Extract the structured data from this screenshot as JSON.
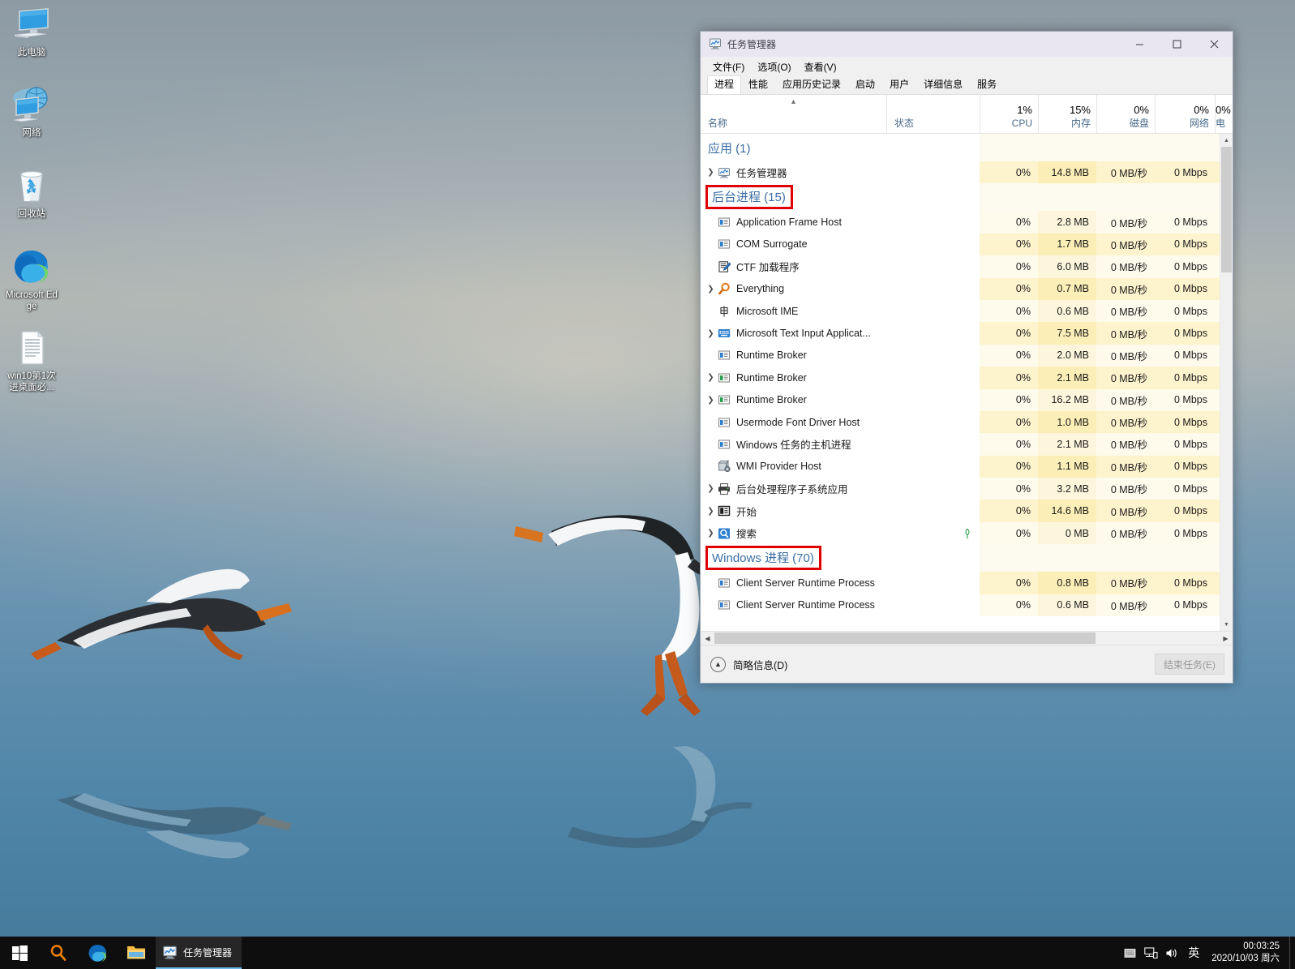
{
  "desktop": {
    "icons": [
      {
        "name": "this-pc",
        "label": "此电脑",
        "icon": "monitor-icon"
      },
      {
        "name": "network",
        "label": "网络",
        "icon": "network-globe-icon"
      },
      {
        "name": "recycle-bin",
        "label": "回收站",
        "icon": "recycle-bin-icon"
      },
      {
        "name": "microsoft-edge",
        "label": "Microsoft Edge",
        "icon": "edge-icon"
      },
      {
        "name": "text-file",
        "label": "win10第1次进桌面必...",
        "icon": "text-document-icon"
      }
    ]
  },
  "taskmanager": {
    "title": "任务管理器",
    "titlebar_icon": "task-manager-icon",
    "window_buttons": {
      "minimize": "─",
      "maximize": "☐",
      "close": "✕"
    },
    "menu": [
      "文件(F)",
      "选项(O)",
      "查看(V)"
    ],
    "tabs": [
      {
        "label": "进程",
        "active": true
      },
      {
        "label": "性能",
        "active": false
      },
      {
        "label": "应用历史记录",
        "active": false
      },
      {
        "label": "启动",
        "active": false
      },
      {
        "label": "用户",
        "active": false
      },
      {
        "label": "详细信息",
        "active": false
      },
      {
        "label": "服务",
        "active": false
      }
    ],
    "columns": [
      {
        "key": "name",
        "label": "名称",
        "value": "",
        "sorted": true
      },
      {
        "key": "status",
        "label": "状态",
        "value": ""
      },
      {
        "key": "cpu",
        "label": "CPU",
        "value": "1%"
      },
      {
        "key": "memory",
        "label": "内存",
        "value": "15%"
      },
      {
        "key": "disk",
        "label": "磁盘",
        "value": "0%"
      },
      {
        "key": "network",
        "label": "网络",
        "value": "0%"
      },
      {
        "key": "power",
        "label": "电",
        "value": "0%"
      }
    ],
    "groups": [
      {
        "label": "应用 (1)",
        "boxed": false,
        "rows": [
          {
            "name": "任务管理器",
            "icon": "task-manager-icon",
            "expandable": true,
            "status": "",
            "cpu": "0%",
            "memory": "14.8 MB",
            "disk": "0 MB/秒",
            "network": "0 Mbps"
          }
        ]
      },
      {
        "label": "后台进程 (15)",
        "boxed": true,
        "rows": [
          {
            "name": "Application Frame Host",
            "icon": "window-blue-icon",
            "expandable": false,
            "status": "",
            "cpu": "0%",
            "memory": "2.8 MB",
            "disk": "0 MB/秒",
            "network": "0 Mbps"
          },
          {
            "name": "COM Surrogate",
            "icon": "window-blue-icon",
            "expandable": false,
            "status": "",
            "cpu": "0%",
            "memory": "1.7 MB",
            "disk": "0 MB/秒",
            "network": "0 Mbps"
          },
          {
            "name": "CTF 加载程序",
            "icon": "pen-notepad-icon",
            "expandable": false,
            "status": "",
            "cpu": "0%",
            "memory": "6.0 MB",
            "disk": "0 MB/秒",
            "network": "0 Mbps"
          },
          {
            "name": "Everything",
            "icon": "magnifier-orange-icon",
            "expandable": true,
            "status": "",
            "cpu": "0%",
            "memory": "0.7 MB",
            "disk": "0 MB/秒",
            "network": "0 Mbps"
          },
          {
            "name": "Microsoft IME",
            "icon": "ime-zhong-icon",
            "expandable": false,
            "status": "",
            "cpu": "0%",
            "memory": "0.6 MB",
            "disk": "0 MB/秒",
            "network": "0 Mbps"
          },
          {
            "name": "Microsoft Text Input Applicat...",
            "icon": "keyboard-blue-icon",
            "expandable": true,
            "status": "",
            "cpu": "0%",
            "memory": "7.5 MB",
            "disk": "0 MB/秒",
            "network": "0 Mbps"
          },
          {
            "name": "Runtime Broker",
            "icon": "window-blue-icon",
            "expandable": false,
            "status": "",
            "cpu": "0%",
            "memory": "2.0 MB",
            "disk": "0 MB/秒",
            "network": "0 Mbps"
          },
          {
            "name": "Runtime Broker",
            "icon": "window-green-icon",
            "expandable": true,
            "status": "",
            "cpu": "0%",
            "memory": "2.1 MB",
            "disk": "0 MB/秒",
            "network": "0 Mbps"
          },
          {
            "name": "Runtime Broker",
            "icon": "window-green-icon",
            "expandable": true,
            "status": "",
            "cpu": "0%",
            "memory": "16.2 MB",
            "disk": "0 MB/秒",
            "network": "0 Mbps"
          },
          {
            "name": "Usermode Font Driver Host",
            "icon": "window-blue-icon",
            "expandable": false,
            "status": "",
            "cpu": "0%",
            "memory": "1.0 MB",
            "disk": "0 MB/秒",
            "network": "0 Mbps"
          },
          {
            "name": "Windows 任务的主机进程",
            "icon": "window-blue-icon",
            "expandable": false,
            "status": "",
            "cpu": "0%",
            "memory": "2.1 MB",
            "disk": "0 MB/秒",
            "network": "0 Mbps"
          },
          {
            "name": "WMI Provider Host",
            "icon": "wmi-gear-icon",
            "expandable": false,
            "status": "",
            "cpu": "0%",
            "memory": "1.1 MB",
            "disk": "0 MB/秒",
            "network": "0 Mbps"
          },
          {
            "name": "后台处理程序子系统应用",
            "icon": "printer-icon",
            "expandable": true,
            "status": "",
            "cpu": "0%",
            "memory": "3.2 MB",
            "disk": "0 MB/秒",
            "network": "0 Mbps"
          },
          {
            "name": "开始",
            "icon": "start-window-icon",
            "expandable": true,
            "status": "",
            "cpu": "0%",
            "memory": "14.6 MB",
            "disk": "0 MB/秒",
            "network": "0 Mbps"
          },
          {
            "name": "搜索",
            "icon": "magnifier-blue-icon",
            "expandable": true,
            "status": "suspended-leaf-icon",
            "cpu": "0%",
            "memory": "0 MB",
            "disk": "0 MB/秒",
            "network": "0 Mbps"
          }
        ]
      },
      {
        "label": "Windows 进程 (70)",
        "boxed": true,
        "rows": [
          {
            "name": "Client Server Runtime Process",
            "icon": "window-blue-icon",
            "expandable": false,
            "status": "",
            "cpu": "0%",
            "memory": "0.8 MB",
            "disk": "0 MB/秒",
            "network": "0 Mbps"
          },
          {
            "name": "Client Server Runtime Process",
            "icon": "window-blue-icon",
            "expandable": false,
            "status": "",
            "cpu": "0%",
            "memory": "0.6 MB",
            "disk": "0 MB/秒",
            "network": "0 Mbps"
          }
        ]
      }
    ],
    "statusbar": {
      "fewer_details_label": "简略信息(D)",
      "fewer_details_icon": "chevron-up-circle-icon",
      "end_task_label": "结束任务(E)",
      "end_task_disabled": true
    },
    "scroll": {
      "h_left_icon": "chevron-left-icon",
      "h_right_icon": "chevron-right-icon",
      "v_up_icon": "caret-up-icon",
      "v_down_icon": "caret-down-icon"
    }
  },
  "taskbar": {
    "start_icon": "windows-start-icon",
    "search_icon": "search-magnifier-icon",
    "edge_icon": "edge-icon",
    "explorer_icon": "file-explorer-icon",
    "open_window": {
      "label": "任务管理器",
      "icon": "task-manager-icon"
    },
    "tray": {
      "icons": [
        "tray-keyboard-icon",
        "network-wired-icon",
        "volume-icon"
      ],
      "ime_label": "英"
    },
    "clock": {
      "time": "00:03:25",
      "date": "2020/10/03 周六"
    }
  },
  "colors": {
    "accent_blue": "#3b6ea5",
    "highlight_red": "#e00000",
    "heat_yellow": "#fbeeb7",
    "taskbar_bg": "#0e0e0e"
  }
}
